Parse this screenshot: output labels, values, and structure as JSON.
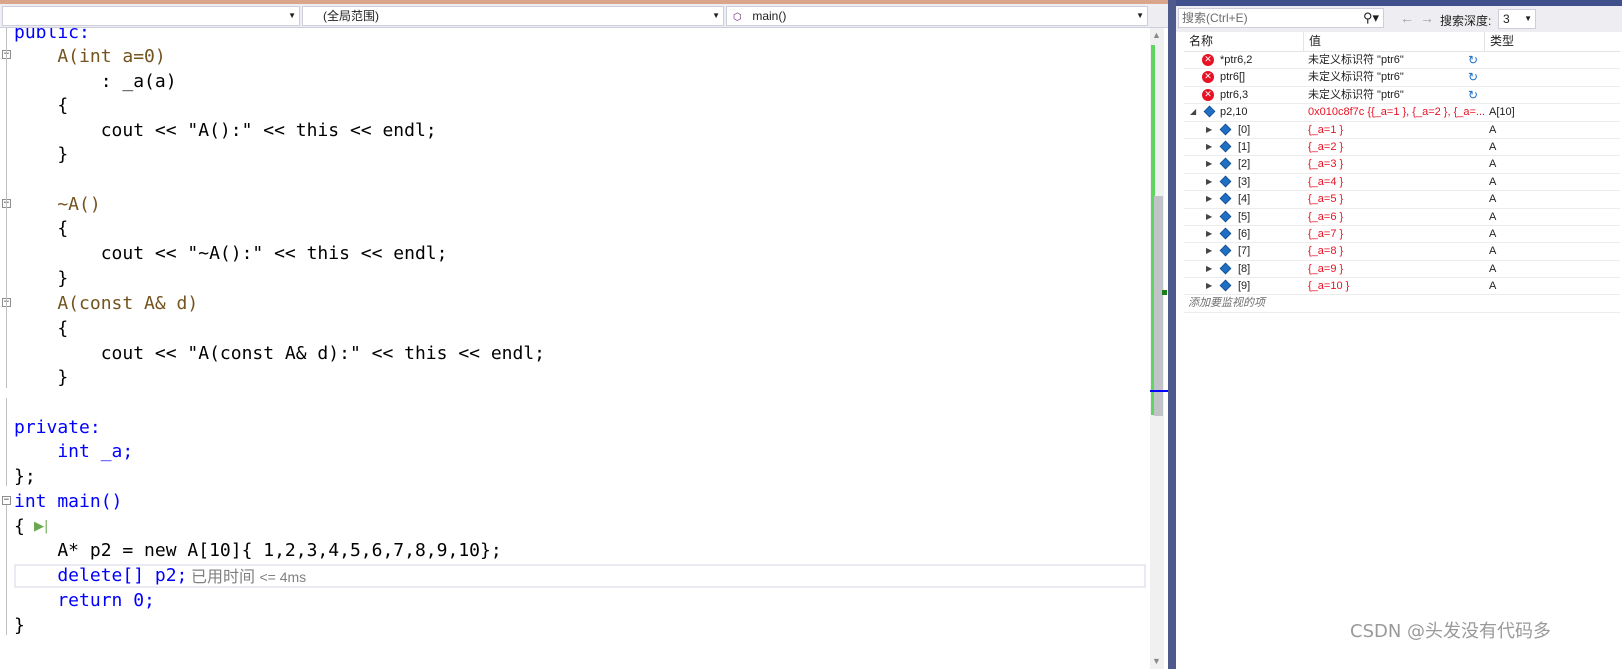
{
  "editor": {
    "nav": {
      "project_dropdown": "",
      "scope_dropdown": "(全局范围)",
      "function_dropdown": "main()",
      "split_icon": "split-icon"
    },
    "code_lines": [
      "public:",
      "    A(int a=0)",
      "        : _a(a)",
      "    {",
      "        cout << \"A():\" << this << endl;",
      "    }",
      "",
      "    ~A()",
      "    {",
      "        cout << \"~A():\" << this << endl;",
      "    }",
      "    A(const A& d)",
      "    {",
      "        cout << \"A(const A& d):\" << this << endl;",
      "    }",
      "",
      "private:",
      "    int _a;",
      "};",
      "int main()",
      "{",
      "    A* p2 = new A[10]{ 1,2,3,4,5,6,7,8,9,10};",
      "    delete[] p2;",
      "    return 0;",
      "}"
    ],
    "perf_hint": {
      "label": "已用时间",
      "value": "<= 4ms"
    },
    "run_icon": "run-to-cursor-icon"
  },
  "watch": {
    "search_placeholder": "搜索(Ctrl+E)",
    "depth_label": "搜索深度:",
    "depth_value": "3",
    "columns": {
      "name": "名称",
      "value": "值",
      "type": "类型"
    },
    "error_rows": [
      {
        "name": "*ptr6,2",
        "value": "未定义标识符 \"ptr6\"",
        "type": ""
      },
      {
        "name": "ptr6[]",
        "value": "未定义标识符 \"ptr6\"",
        "type": ""
      },
      {
        "name": "ptr6,3",
        "value": "未定义标识符 \"ptr6\"",
        "type": ""
      }
    ],
    "array_row": {
      "name": "p2,10",
      "value": "0x010c8f7c {{_a=1 }, {_a=2 }, {_a=...",
      "type": "A[10]"
    },
    "children": [
      {
        "name": "[0]",
        "value": "{_a=1 }",
        "type": "A"
      },
      {
        "name": "[1]",
        "value": "{_a=2 }",
        "type": "A"
      },
      {
        "name": "[2]",
        "value": "{_a=3 }",
        "type": "A"
      },
      {
        "name": "[3]",
        "value": "{_a=4 }",
        "type": "A"
      },
      {
        "name": "[4]",
        "value": "{_a=5 }",
        "type": "A"
      },
      {
        "name": "[5]",
        "value": "{_a=6 }",
        "type": "A"
      },
      {
        "name": "[6]",
        "value": "{_a=7 }",
        "type": "A"
      },
      {
        "name": "[7]",
        "value": "{_a=8 }",
        "type": "A"
      },
      {
        "name": "[8]",
        "value": "{_a=9 }",
        "type": "A"
      },
      {
        "name": "[9]",
        "value": "{_a=10 }",
        "type": "A"
      }
    ],
    "add_watch_placeholder": "添加要监视的项"
  },
  "watermark": "CSDN @头发没有代码多",
  "colors": {
    "keyword": "#0000ff",
    "class": "#2b91af",
    "string": "#a31515",
    "error": "#e81123",
    "divider": "#4d5a8b"
  }
}
